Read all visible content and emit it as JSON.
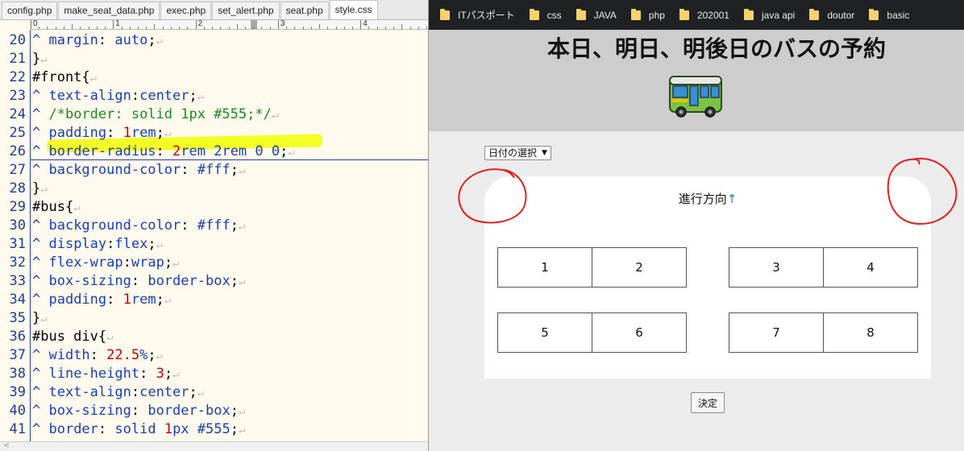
{
  "editor": {
    "tabs": [
      {
        "label": "config.php"
      },
      {
        "label": "make_seat_data.php"
      },
      {
        "label": "exec.php"
      },
      {
        "label": "set_alert.php"
      },
      {
        "label": "seat.php"
      },
      {
        "label": "style.css",
        "active": true
      }
    ],
    "ruler_labels": [
      "0",
      "1",
      "2",
      "3",
      "4"
    ],
    "line_numbers": [
      "20",
      "21",
      "22",
      "23",
      "24",
      "25",
      "26",
      "27",
      "28",
      "29",
      "30",
      "31",
      "32",
      "33",
      "34",
      "35",
      "36",
      "37",
      "38",
      "39",
      "40",
      "41"
    ],
    "lines": [
      {
        "indent": true,
        "prop": "margin",
        "sep": ": ",
        "val": "auto",
        "tail": ";"
      },
      {
        "raw": "}"
      },
      {
        "raw": "#front{"
      },
      {
        "indent": true,
        "prop": "text-align",
        "sep": ":",
        "val": "center",
        "tail": ";"
      },
      {
        "indent": true,
        "comment": "/*border: solid 1px #555;*/"
      },
      {
        "indent": true,
        "prop": "padding",
        "sep": ": ",
        "num": "1",
        "val": "rem",
        "tail": ";"
      },
      {
        "indent": true,
        "prop": "border-radius",
        "sep": ": ",
        "num": "2",
        "val": "rem 2rem 0 0",
        "tail": ";"
      },
      {
        "indent": true,
        "prop": "background-color",
        "sep": ": ",
        "val": "#fff",
        "tail": ";"
      },
      {
        "raw": "}"
      },
      {
        "raw": "#bus{"
      },
      {
        "indent": true,
        "prop": "background-color",
        "sep": ": ",
        "val": "#fff",
        "tail": ";"
      },
      {
        "indent": true,
        "prop": "display",
        "sep": ":",
        "val": "flex",
        "tail": ";"
      },
      {
        "indent": true,
        "prop": "flex-wrap",
        "sep": ":",
        "val": "wrap",
        "tail": ";"
      },
      {
        "indent": true,
        "prop": "box-sizing",
        "sep": ": ",
        "val": "border-box",
        "tail": ";"
      },
      {
        "indent": true,
        "prop": "padding",
        "sep": ": ",
        "num": "1",
        "val": "rem",
        "tail": ";"
      },
      {
        "raw": "}"
      },
      {
        "raw": "#bus div{"
      },
      {
        "indent": true,
        "prop": "width",
        "sep": ": ",
        "num": "22.5",
        "val": "%",
        "tail": ";"
      },
      {
        "indent": true,
        "prop": "line-height",
        "sep": ": ",
        "num": "3",
        "val": "",
        "tail": ";"
      },
      {
        "indent": true,
        "prop": "text-align",
        "sep": ":",
        "val": "center",
        "tail": ";"
      },
      {
        "indent": true,
        "prop": "box-sizing",
        "sep": ": ",
        "val": "border-box",
        "tail": ";"
      },
      {
        "indent": true,
        "prop": "border",
        "sep": ": ",
        "val": "solid ",
        "num": "1",
        "val2": "px #555",
        "tail": ";"
      }
    ]
  },
  "browser": {
    "bookmarks": [
      {
        "label": "ITパスポート"
      },
      {
        "label": "css"
      },
      {
        "label": "JAVA"
      },
      {
        "label": "php"
      },
      {
        "label": "202001"
      },
      {
        "label": "java api"
      },
      {
        "label": "doutor"
      },
      {
        "label": "basic"
      }
    ],
    "page_title": "本日、明日、明後日のバスの予約",
    "date_select": "日付の選択",
    "direction_label": "進行方向",
    "direction_arrow": "↑",
    "seats": [
      "1",
      "2",
      "3",
      "4",
      "5",
      "6",
      "7",
      "8"
    ],
    "submit_label": "決定"
  },
  "colors": {
    "bookmark_bar": "#202124",
    "header_bg": "#cdcdcd",
    "page_bg": "#ececec",
    "annotation_red": "#e02020",
    "highlight_yellow": "#f2ff00"
  }
}
